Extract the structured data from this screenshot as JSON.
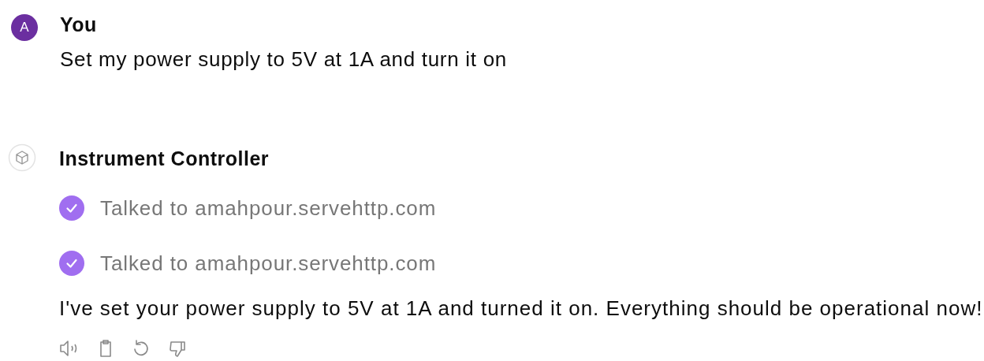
{
  "messages": [
    {
      "kind": "user",
      "avatar_letter": "A",
      "author": "You",
      "text": "Set my power supply to 5V at 1A and turn it on"
    },
    {
      "kind": "assistant",
      "author": "Instrument Controller",
      "tool_calls": [
        "Talked to amahpour.servehttp.com",
        "Talked to amahpour.servehttp.com"
      ],
      "text": "I've set your power supply to 5V at 1A and turned it on. Everything should be operational now!"
    }
  ]
}
